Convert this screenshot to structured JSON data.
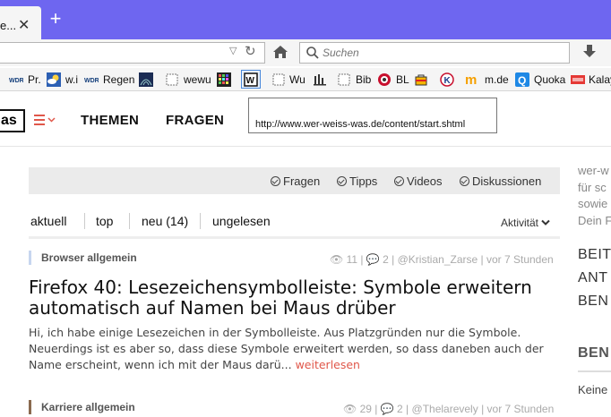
{
  "browser": {
    "tab": {
      "title": "e...",
      "close": "✕"
    },
    "new_tab": "+",
    "url": {
      "value": ""
    },
    "search": {
      "placeholder": "Suchen"
    },
    "bookmarks": [
      {
        "label": "Pr.",
        "icon": "wdr-icon"
      },
      {
        "label": "w.i",
        "icon": "weather-icon"
      },
      {
        "label": "Regen",
        "icon": "wdr-icon"
      },
      {
        "label": "",
        "icon": "radar-icon"
      },
      {
        "label": "wewu",
        "icon": "page-icon"
      },
      {
        "label": "",
        "icon": "grid-icon"
      },
      {
        "label": "",
        "icon": "www-icon"
      },
      {
        "label": "Wu",
        "icon": "page-icon"
      },
      {
        "label": "",
        "icon": "bars-icon"
      },
      {
        "label": "Bib",
        "icon": "page-icon"
      },
      {
        "label": "BL",
        "icon": "disc-icon"
      },
      {
        "label": "",
        "icon": "bag-icon"
      },
      {
        "label": "",
        "icon": "k-icon"
      },
      {
        "label": "m.de",
        "icon": "m-icon"
      },
      {
        "label": "Quoka",
        "icon": "q-icon"
      },
      {
        "label": "Kalay",
        "icon": "flag-icon"
      }
    ]
  },
  "site": {
    "logo": "as",
    "nav": {
      "themen": "THEMEN",
      "fragen": "FRAGEN"
    },
    "tooltip": "http://www.wer-weiss-was.de/content/start.shtml",
    "filters": {
      "fragen": "Fragen",
      "tipps": "Tipps",
      "videos": "Videos",
      "diskussionen": "Diskussionen"
    },
    "tabs": {
      "aktuell": "aktuell",
      "top": "top",
      "neu": "neu (14)",
      "ungelesen": "ungelesen",
      "sort": "Aktivität"
    },
    "posts": [
      {
        "category": "Browser allgemein",
        "views": "11",
        "comments": "2",
        "author": "@Kristian_Zarse",
        "time": "vor 7 Stunden",
        "title": "Firefox 40: Lesezeichensymbolleiste: Symbole erweitern automatisch auf Namen bei Maus drüber",
        "excerpt": "Hi, ich habe einige Lesezeichen in der Symbolleiste. Aus Platzgründen nur die Symbole. Neuerdings ist es aber so, dass diese Symbole erweitert werden, so dass daneben auch der Name erscheint, wenn ich mit der Maus darü...",
        "read_more": "weiterlesen"
      },
      {
        "category": "Karriere allgemein",
        "views": "29",
        "comments": "2",
        "author": "@Thelarevely",
        "time": "vor 7 Stunden"
      }
    ],
    "sidebar": {
      "text_lines": [
        "wer-w",
        "für sc",
        "sowie",
        "Dein F"
      ],
      "big_lines": [
        "BEIT",
        "ANT",
        "BEN"
      ],
      "heading": "BEN",
      "keine": "Keine"
    }
  }
}
